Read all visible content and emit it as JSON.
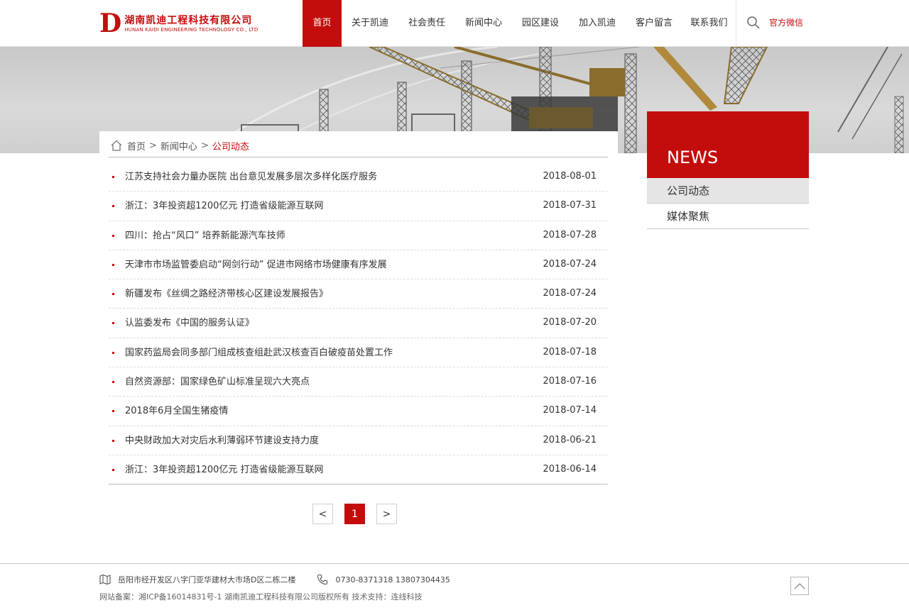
{
  "header": {
    "logo_letter": "D",
    "logo_cn": "湖南凯迪工程科技有限公司",
    "logo_en": "HUNAN KAIDI ENGINEERING TECHNOLOGY CO., LTD",
    "nav": [
      "首页",
      "关于凯迪",
      "社会责任",
      "新闻中心",
      "园区建设",
      "加入凯迪",
      "客户留言",
      "联系我们"
    ],
    "active_nav_index": 0,
    "wechat_label": "官方微信",
    "accent_color": "#c30d0d"
  },
  "breadcrumb": {
    "home": "首页",
    "sep": ">",
    "section": "新闻中心",
    "current": "公司动态"
  },
  "news": [
    {
      "title": "江苏支持社会力量办医院 出台意见发展多层次多样化医疗服务",
      "date": "2018-08-01"
    },
    {
      "title": "浙江：3年投资超1200亿元 打造省级能源互联网",
      "date": "2018-07-31"
    },
    {
      "title": "四川：抢占“风口” 培养新能源汽车技师",
      "date": "2018-07-28"
    },
    {
      "title": "天津市市场监管委启动“网剑行动” 促进市网络市场健康有序发展",
      "date": "2018-07-24"
    },
    {
      "title": "新疆发布《丝绸之路经济带核心区建设发展报告》",
      "date": "2018-07-24"
    },
    {
      "title": "认监委发布《中国的服务认证》",
      "date": "2018-07-20"
    },
    {
      "title": "国家药监局会同多部门组成核查组赴武汉核查百白破疫苗处置工作",
      "date": "2018-07-18"
    },
    {
      "title": "自然资源部：国家绿色矿山标准呈现六大亮点",
      "date": "2018-07-16"
    },
    {
      "title": "2018年6月全国生猪疫情",
      "date": "2018-07-14"
    },
    {
      "title": "中央财政加大对灾后水利薄弱环节建设支持力度",
      "date": "2018-06-21"
    },
    {
      "title": "浙江：3年投资超1200亿元 打造省级能源互联网",
      "date": "2018-06-14"
    }
  ],
  "pager": {
    "prev": "<",
    "current": "1",
    "next": ">"
  },
  "sidebar": {
    "title": "NEWS",
    "items": [
      "公司动态",
      "媒体聚焦"
    ],
    "active_index": 0
  },
  "footer": {
    "address": "岳阳市经开发区八字门亚华建材大市场D区二栋二楼",
    "phone": "0730-8371318 13807304435",
    "copyright": "网站备案：湘ICP备16014831号-1   湖南凯迪工程科技有限公司版权所有  技术支持：连线科技"
  }
}
